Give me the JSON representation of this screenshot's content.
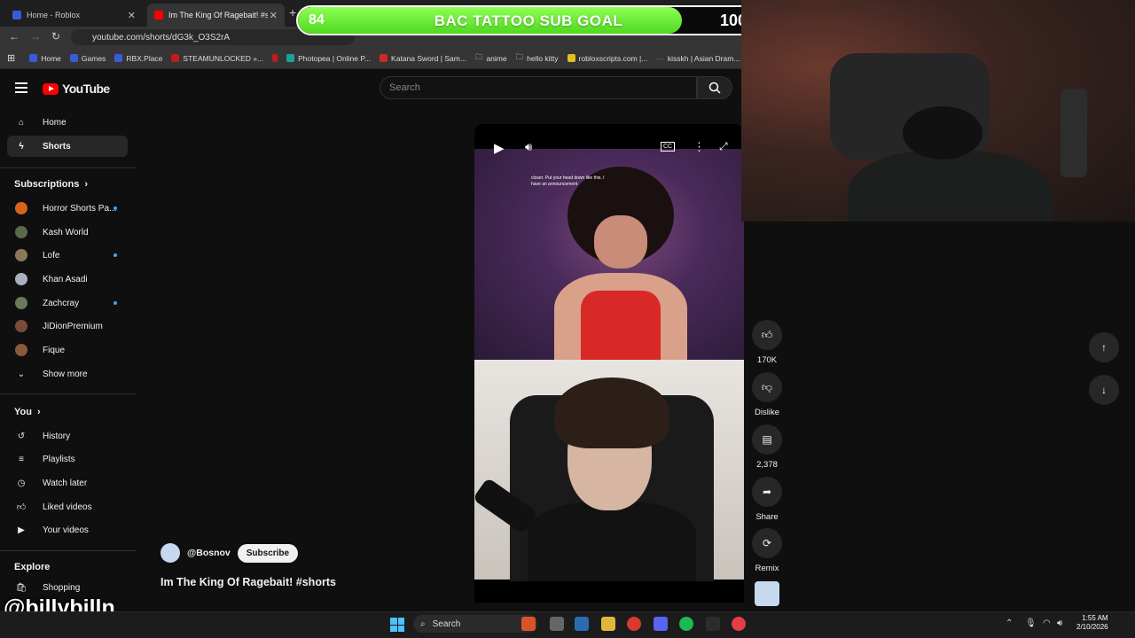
{
  "browser": {
    "tabs": [
      {
        "label": "Home - Roblox"
      },
      {
        "label": "Im The King Of Ragebait! #shor"
      }
    ],
    "new_tab": "+",
    "url": "youtube.com/shorts/dG3k_O3S2rA",
    "bookmarks": [
      {
        "label": "Home",
        "color": "#3a5bd9"
      },
      {
        "label": "Games",
        "color": "#3a5bd9"
      },
      {
        "label": "RBX.Place",
        "color": "#3a5bd9"
      },
      {
        "label": "STEAMUNLOCKED »...",
        "color": "#c21c1c"
      },
      {
        "label": "",
        "color": "#c21c1c"
      },
      {
        "label": "Photopea | Online P...",
        "color": "#18a497"
      },
      {
        "label": "Katana Sword | Sam...",
        "color": "#d02727"
      },
      {
        "label": "anime",
        "color": "folder"
      },
      {
        "label": "hello kitty",
        "color": "folder"
      },
      {
        "label": "robloxscripts.com |...",
        "color": "#e0c020"
      },
      {
        "label": "kisskh | Asian Dram...",
        "color": "#888888"
      }
    ]
  },
  "sub_goal": {
    "current": "84",
    "title": "BAC TATTOO SUB GOAL",
    "target": "100",
    "progress": 0.84
  },
  "youtube": {
    "logo": "YouTube",
    "search_placeholder": "Search",
    "sidebar": {
      "main": [
        {
          "label": "Home",
          "icon": "home-icon"
        },
        {
          "label": "Shorts",
          "icon": "shorts-icon",
          "active": true
        }
      ],
      "subscriptions_header": "Subscriptions",
      "subscriptions": [
        {
          "label": "Horror Shorts Pa...",
          "new": true,
          "color": "#d9631c"
        },
        {
          "label": "Kash World",
          "new": false,
          "color": "#5a6b4a"
        },
        {
          "label": "Lofe",
          "new": true,
          "color": "#8a7a5a"
        },
        {
          "label": "Khan Asadi",
          "new": false,
          "color": "#aab0c0"
        },
        {
          "label": "Zachcray",
          "new": true,
          "color": "#6a7a5a"
        },
        {
          "label": "JiDionPremium",
          "new": false,
          "color": "#7a4a3a"
        },
        {
          "label": "Fique",
          "new": false,
          "color": "#8a5a3a"
        }
      ],
      "show_more": "Show more",
      "you_header": "You",
      "you": [
        {
          "label": "History",
          "icon": "history-icon"
        },
        {
          "label": "Playlists",
          "icon": "playlists-icon"
        },
        {
          "label": "Watch later",
          "icon": "watch-later-icon"
        },
        {
          "label": "Liked videos",
          "icon": "liked-videos-icon"
        },
        {
          "label": "Your videos",
          "icon": "your-videos-icon"
        }
      ],
      "explore_header": "Explore",
      "explore": [
        {
          "label": "Shopping",
          "icon": "shopping-icon"
        }
      ]
    },
    "short": {
      "caption": "closer. Put your head down like this. I have an announcement",
      "progress": 0.55,
      "channel": "@Bosnov",
      "subscribe": "Subscribe",
      "title": "Im The King Of Ragebait! #shorts",
      "cc": "CC"
    },
    "actions": {
      "likes": "170K",
      "dislike": "Dislike",
      "comments": "2,378",
      "share": "Share",
      "remix": "Remix"
    }
  },
  "watermark": "@billybilln",
  "taskbar": {
    "search": "Search",
    "time": "1:55 AM",
    "date": "2/10/2026"
  }
}
